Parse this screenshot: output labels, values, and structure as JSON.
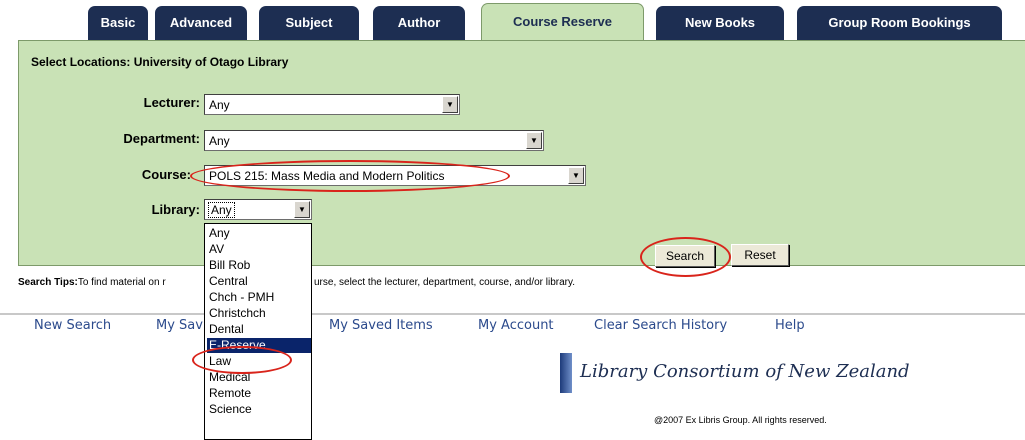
{
  "tabs": [
    {
      "label": "Basic"
    },
    {
      "label": "Advanced"
    },
    {
      "label": "Subject"
    },
    {
      "label": "Author"
    },
    {
      "label": "Course Reserve"
    },
    {
      "label": "New Books"
    },
    {
      "label": "Group Room Bookings"
    }
  ],
  "panel": {
    "title": "Select Locations: University of Otago Library"
  },
  "form": {
    "lecturer": {
      "label": "Lecturer:",
      "value": "Any"
    },
    "department": {
      "label": "Department:",
      "value": "Any"
    },
    "course": {
      "label": "Course:",
      "value": "POLS 215: Mass Media and Modern Politics"
    },
    "library": {
      "label": "Library:",
      "value": "Any"
    }
  },
  "buttons": {
    "search": "Search",
    "reset": "Reset"
  },
  "search_tips": {
    "heading": "Search Tips:",
    "text_left": "To find material on r",
    "text_right": "urse, select the lecturer, department, course, and/or library."
  },
  "footer": {
    "links": [
      {
        "label": "New Search"
      },
      {
        "label": "My Sav"
      },
      {
        "label": "My Saved Items"
      },
      {
        "label": "My Account"
      },
      {
        "label": "Clear Search History"
      },
      {
        "label": "Help"
      }
    ],
    "logo_text": "Library Consortium of New Zealand",
    "copyright": "@2007 Ex Libris Group. All rights reserved."
  },
  "library_dropdown": {
    "options": [
      "Any",
      "AV",
      "Bill Rob",
      "Central",
      "Chch - PMH",
      "Christchch",
      "Dental",
      "E-Reserve",
      "Law",
      "Medical",
      "Remote",
      "Science"
    ],
    "highlighted": "E-Reserve"
  },
  "colors": {
    "tab_bg": "#1d2e52",
    "panel_bg": "#c9e2b6",
    "annotation": "#d9241b",
    "link": "#2b4a8c"
  }
}
